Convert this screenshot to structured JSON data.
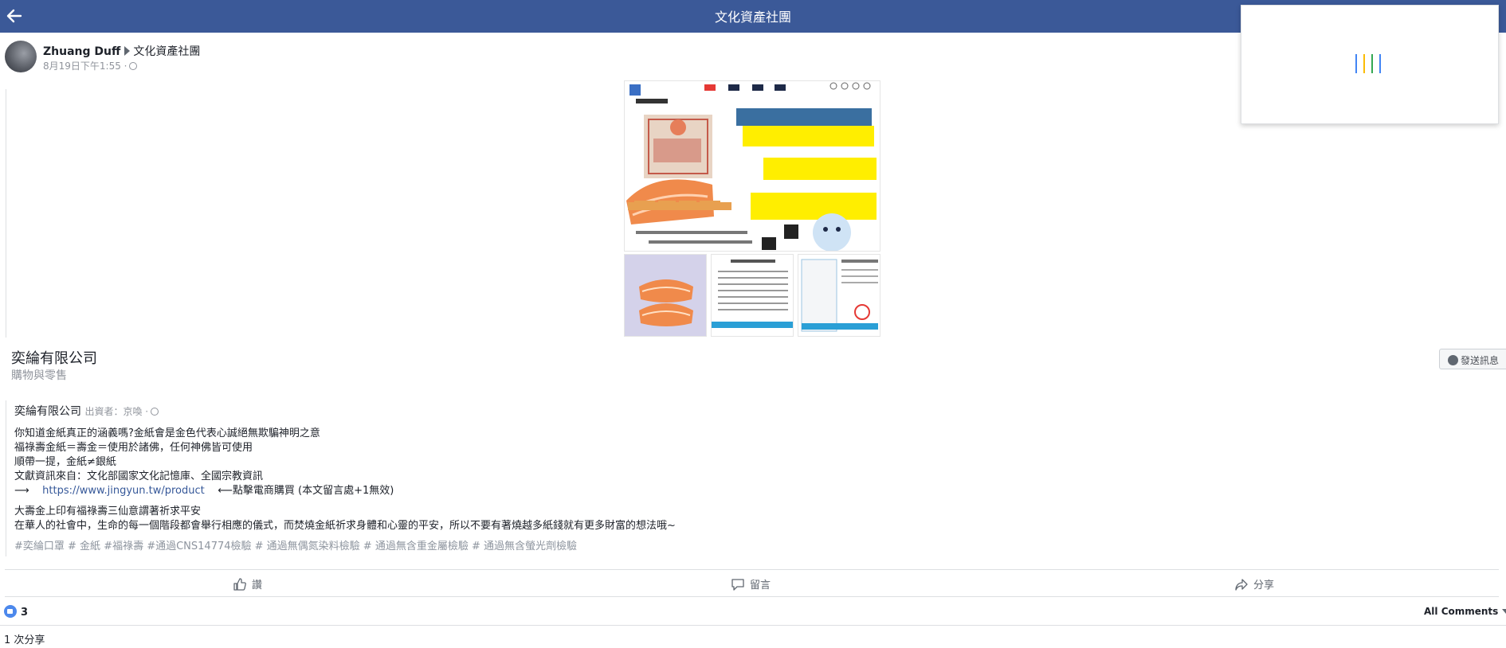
{
  "topbar": {
    "title": "文化資產社團",
    "background": "#3b5998",
    "back_icon": "arrow-left-icon"
  },
  "post": {
    "author": "Zhuang Duff",
    "group": "文化資產社團",
    "timestamp": "8月19日下午1:55 ·",
    "privacy_icon": "globe-icon"
  },
  "shared_page": {
    "name": "奕綸有限公司",
    "category": "購物與零售",
    "message_button": "發送訊息"
  },
  "shared_post": {
    "page_name": "奕綸有限公司",
    "sub": "出資者：京喚 ·",
    "body": [
      "你知道金紙真正的涵義嗎?金紙會是金色代表心誠絕無欺騙神明之意",
      "福祿壽金紙＝壽金＝使用於諸佛，任何神佛皆可使用",
      "順帶一提，金紙≠銀紙",
      "文獻資訊來自：文化部國家文化記憶庫、全國宗教資訊"
    ],
    "link_arrow": "⟶",
    "link_url": "https://www.jingyun.tw/product",
    "link_suffix": "⟵點擊電商購買 (本文留言處+1無效)",
    "body2": [
      "大壽金上印有福祿壽三仙意謂著祈求平安",
      "在華人的社會中，生命的每一個階段都會舉行相應的儀式，而焚燒金紙祈求身體和心靈的平安，所以不要有著燒越多紙錢就有更多財富的想法哦~"
    ],
    "hashtags": "#奕綸口罩 # 金紙 #福祿壽 #通過CNS14774檢驗 # 通過無偶氮染料檢驗 # 通過無含重金屬檢驗 # 通過無含螢光劑檢驗"
  },
  "actions": {
    "like": "讚",
    "comment": "留言",
    "share": "分享"
  },
  "reactions": {
    "count": "3",
    "sort_label": "All Comments",
    "shares": "1 次分享"
  },
  "colors": {
    "accent": "#3b5998",
    "link": "#365899",
    "muted": "#90949c",
    "mask_orange": "#f08a4b",
    "highlight_yellow": "#ffee00"
  }
}
